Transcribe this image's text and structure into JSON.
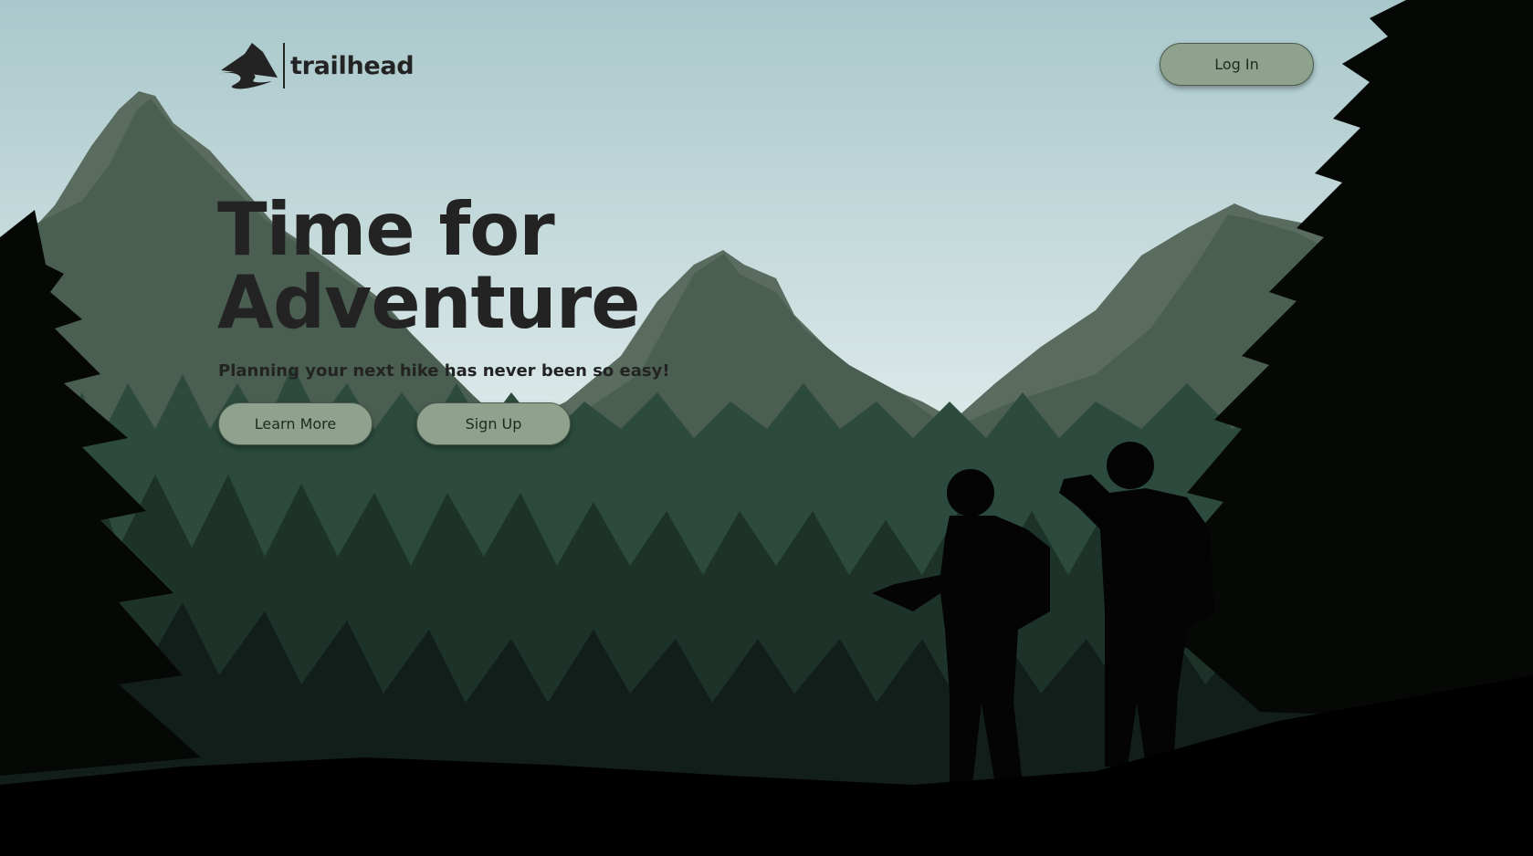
{
  "brand": {
    "name": "trailhead",
    "logo_icon": "mountain-trail-icon"
  },
  "nav": {
    "login_label": "Log In"
  },
  "hero": {
    "headline_line1": "Time for",
    "headline_line2": "Adventure",
    "subheadline": "Planning your next hike has never been so easy!",
    "learn_more_label": "Learn More",
    "sign_up_label": "Sign Up"
  },
  "colors": {
    "sky_top": "#a9c8cb",
    "sky_bottom": "#dce9e9",
    "button_fill": "#8fa28e",
    "text_dark": "#232323"
  }
}
